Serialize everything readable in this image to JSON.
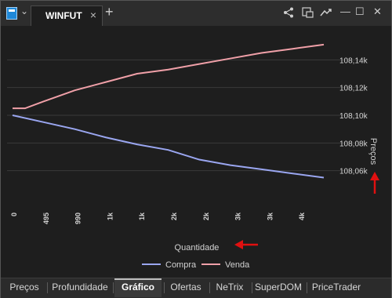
{
  "window": {
    "tab_title": "WINFUT",
    "tab_close": "×",
    "new_tab": "+",
    "dropdown": "⌄",
    "toolbar": {
      "share": "share-icon",
      "popout": "popout-icon",
      "trend": "trend-icon",
      "min": "—",
      "max": "☐",
      "close": "✕"
    }
  },
  "chart_data": {
    "type": "line",
    "x_tick_labels": [
      "0",
      "495",
      "990",
      "1k",
      "1k",
      "2k",
      "2k",
      "3k",
      "3k",
      "4k"
    ],
    "y_ticks": [
      108.06,
      108.08,
      108.1,
      108.12,
      108.14
    ],
    "y_tick_labels": [
      "108,06k",
      "108,08k",
      "108,10k",
      "108,12k",
      "108,14k"
    ],
    "ylim": [
      108.04,
      108.16
    ],
    "xlabel": "Quantidade",
    "ylabel": "Preços",
    "grid": true,
    "legend_position": "bottom",
    "series": [
      {
        "name": "Compra",
        "color": "#9aa6f0",
        "x": [
          0,
          1,
          2,
          3,
          4,
          5,
          6,
          7,
          8,
          9,
          10
        ],
        "values": [
          108.1,
          108.095,
          108.09,
          108.084,
          108.079,
          108.075,
          108.068,
          108.064,
          108.061,
          108.058,
          108.055
        ]
      },
      {
        "name": "Venda",
        "color": "#f0a0a8",
        "x": [
          0,
          0.4,
          1,
          2,
          3,
          4,
          5,
          6,
          7,
          8,
          9,
          10
        ],
        "values": [
          108.105,
          108.105,
          108.11,
          108.118,
          108.124,
          108.13,
          108.133,
          108.137,
          108.141,
          108.145,
          108.148,
          108.151
        ]
      }
    ]
  },
  "bottom_tabs": [
    {
      "label": "Preços",
      "active": false
    },
    {
      "label": "Profundidade",
      "active": false
    },
    {
      "label": "Gráfico",
      "active": true
    },
    {
      "label": "Ofertas",
      "active": false
    },
    {
      "label": "NeTrix",
      "active": false
    },
    {
      "label": "SuperDOM",
      "active": false
    },
    {
      "label": "PriceTrader",
      "active": false
    }
  ]
}
